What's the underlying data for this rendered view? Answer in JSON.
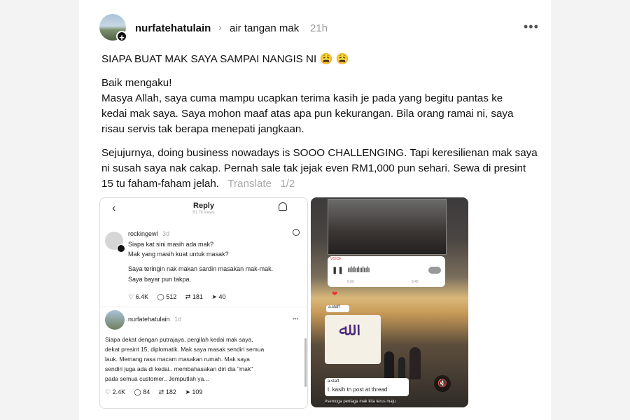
{
  "post": {
    "username": "nurfatehatulain",
    "community": "air tangan mak",
    "time": "21h",
    "more_label": "•••",
    "headline": "SIAPA BUAT MAK SAYA SAMPAI NANGIS NI",
    "headline_emoji": "😩 😩",
    "para1": [
      "Baik mengaku!",
      "Masya Allah, saya cuma mampu ucapkan terima kasih je pada yang begitu pantas ke",
      "kedai mak saya. Saya mohon maaf atas apa pun kekurangan. Bila orang ramai ni, saya",
      "risau servis tak berapa menepati jangkaan."
    ],
    "para2": [
      "Sejujurnya, doing business nowadays is SOOO CHALLENGING. Tapi keresilienan mak saya",
      "ni susah saya nak cakap. Pernah sale tak jejak even RM1,000 pun sehari. Sewa di presint",
      "15 tu faham-faham jelah."
    ],
    "translate_label": "Translate",
    "page_indicator": "1/2"
  },
  "screenshot1": {
    "title": "Reply",
    "subtitle": "61.7k views",
    "reply_user": "rockingewl",
    "reply_time": "3d",
    "reply_lines": [
      "Siapa kat sini masih ada mak?",
      "Mak yang masih kuat untuk masak?"
    ],
    "reply_lines2": [
      "Saya teringin nak makan sardin masakan mak-mak.",
      "Saya bayar pun takpa."
    ],
    "reply_stats": {
      "likes": "6.4K",
      "comments": "512",
      "reposts": "181",
      "shares": "40"
    },
    "op_user": "nurfatehatulain",
    "op_time": "1d",
    "op_lines": [
      "Siapa dekat dengan putrajaya, pergilah kedai mak saya,",
      "dekat presint 15, diplomatik. Mak saya masak sendiri semua",
      "lauk. Memang rasa macam masakan rumah. Mak saya",
      "sendiri juga ada di kedai.. membahasakan diri dia \"mak\"",
      "pada semua customer.. Jemputlah ya..."
    ],
    "op_stats": {
      "likes": "2.4K",
      "comments": "84",
      "reposts": "182",
      "shares": "109"
    }
  },
  "screenshot2": {
    "audio_label": "VOICE",
    "audio_start": "0:00",
    "audio_end": "0:45",
    "msg1_user": "a.staff",
    "msg2_user": "a.staff",
    "msg2_text": "t. kasih tn post at thread",
    "caption": "#semoga peniaga mak kita terus maju"
  }
}
